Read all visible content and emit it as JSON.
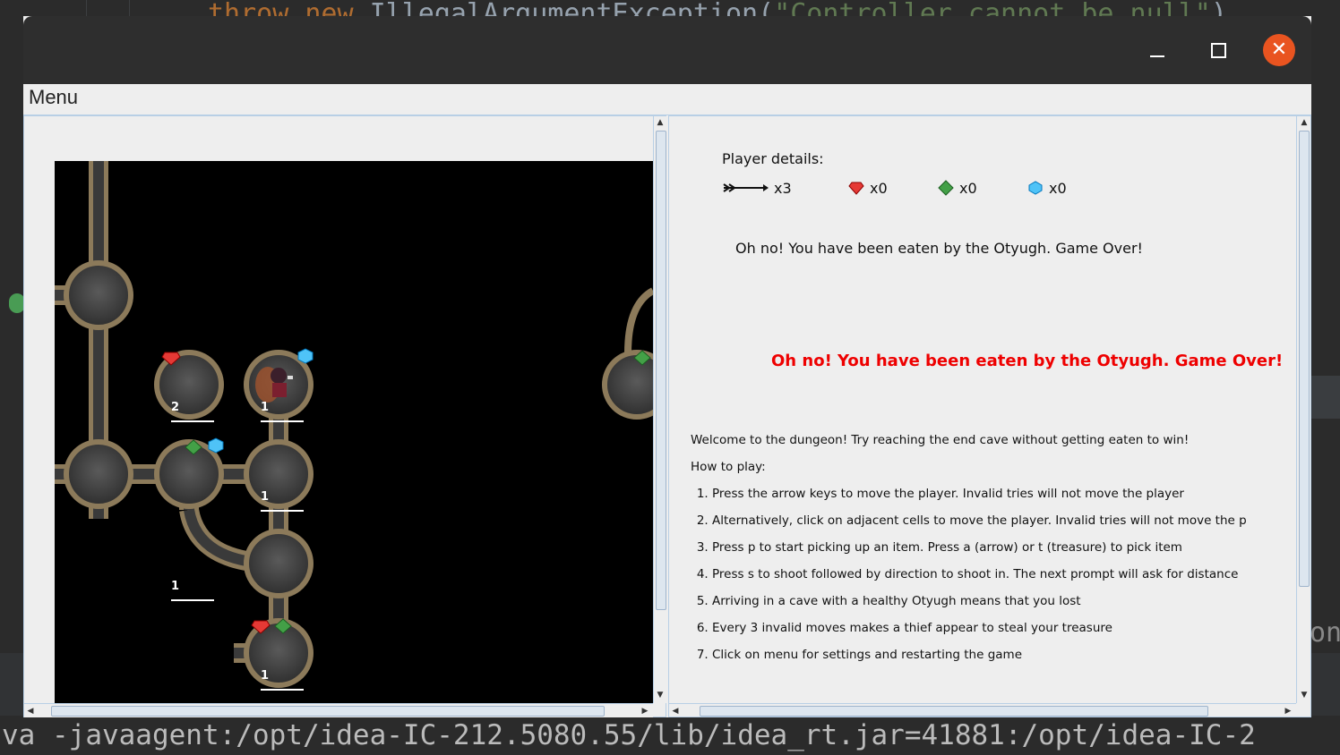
{
  "ide": {
    "code_keyword": "throw new ",
    "code_class": "IllegalArgumentException(",
    "code_string": "\"Controller cannot be null\"",
    "code_end": ")",
    "right_fragment": "on",
    "console_text": "va -javaagent:/opt/idea-IC-212.5080.55/lib/idea_rt.jar=41881:/opt/idea-IC-2"
  },
  "window": {
    "minimize_label": "–",
    "close_label": "✕"
  },
  "menu": {
    "label": "Menu"
  },
  "player": {
    "details_title": "Player details:",
    "arrows": "x3",
    "ruby": "x0",
    "emerald": "x0",
    "diamond": "x0"
  },
  "status_message": "Oh no! You have been eaten by the Otyugh. Game Over!",
  "alert_message": "Oh no! You have been eaten by the Otyugh. Game Over!",
  "instructions": {
    "welcome": "Welcome to the dungeon! Try reaching the end cave without getting eaten to win!",
    "how_to_play": "How to play:",
    "steps": [
      "Press the arrow keys to move the player. Invalid tries will not move the player",
      "Alternatively, click on adjacent cells to move the player. Invalid tries will not move the p",
      "Press p to start picking up an item. Press a (arrow) or t (treasure) to pick item",
      "Press s to shoot followed by direction to shoot in. The next prompt will ask for distance",
      "Arriving in a cave with a healthy Otyugh means that you lost",
      "Every 3 invalid moves makes a thief appear to steal your treasure",
      "Click on menu for settings and restarting the game"
    ]
  },
  "map_arrow_counts": [
    "2",
    "1",
    "1",
    "1",
    "1"
  ],
  "colors": {
    "ruby": "#e53935",
    "emerald": "#43a047",
    "diamond": "#4fc3f7",
    "alert": "#ee0000",
    "close_button": "#e95420"
  }
}
